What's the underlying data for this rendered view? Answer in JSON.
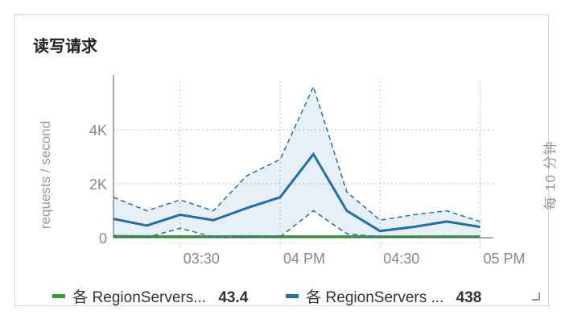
{
  "widget": {
    "title": "读写请求"
  },
  "chart_data": {
    "type": "area",
    "ylabel": "requests / second",
    "right_label": "每 10 分钟",
    "y_ticks": [
      "4K",
      "2K",
      "0"
    ],
    "y_tick_values": [
      4000,
      2000,
      0
    ],
    "ylim": [
      0,
      5500
    ],
    "x_tick_labels": [
      "03:30",
      "04 PM",
      "04:30",
      "05 PM"
    ],
    "x_tick_minutes": [
      30,
      60,
      90,
      120
    ],
    "xlim_minutes": [
      10,
      124
    ],
    "x_minutes": [
      10,
      20,
      30,
      40,
      50,
      60,
      70,
      80,
      90,
      100,
      110,
      120
    ],
    "series": [
      {
        "name": "各 RegionServers...",
        "color": "#2ca02c",
        "values": [
          60,
          50,
          50,
          45,
          50,
          45,
          45,
          45,
          40,
          40,
          45,
          40
        ],
        "upper": [
          60,
          50,
          50,
          45,
          50,
          45,
          45,
          45,
          40,
          40,
          45,
          40
        ],
        "lower": [
          60,
          50,
          50,
          45,
          50,
          45,
          45,
          45,
          40,
          40,
          45,
          40
        ]
      },
      {
        "name": "各 RegionServers ...",
        "color": "#1f6fad",
        "values": [
          700,
          450,
          850,
          650,
          1100,
          1500,
          3100,
          1000,
          250,
          400,
          600,
          400
        ],
        "upper": [
          1500,
          1000,
          1400,
          1000,
          2300,
          2900,
          5600,
          1700,
          650,
          850,
          1000,
          600
        ],
        "lower": [
          50,
          10,
          350,
          30,
          30,
          30,
          1000,
          150,
          20,
          20,
          20,
          20
        ]
      }
    ],
    "legend": [
      {
        "name": "各 RegionServers...",
        "value": "43.4",
        "color": "#2ca02c"
      },
      {
        "name": "各 RegionServers ...",
        "value": "438",
        "color": "#1f6fad"
      }
    ]
  }
}
